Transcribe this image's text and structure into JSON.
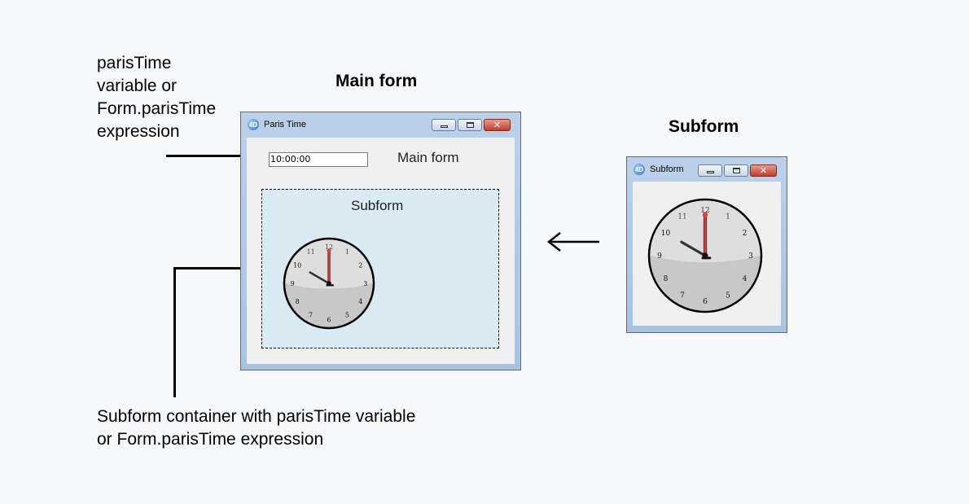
{
  "headings": {
    "main_form": "Main form",
    "subform": "Subform"
  },
  "annotations": {
    "top_left": [
      "parisTime",
      "variable or",
      "Form.parisTime",
      "expression"
    ],
    "bottom": [
      "Subform container with parisTime variable",
      "or Form.parisTime expression"
    ]
  },
  "main_window": {
    "title": "Paris Time",
    "time_value": "10:00:00",
    "label": "Main form",
    "subform_label": "Subform"
  },
  "subform_window": {
    "title": "Subform"
  },
  "window_buttons": {
    "close_glyph": "✕"
  },
  "clock": {
    "numbers": [
      "12",
      "1",
      "2",
      "3",
      "4",
      "5",
      "6",
      "7",
      "8",
      "9",
      "10",
      "11"
    ],
    "hour": 10,
    "minute": 0,
    "second": 0
  },
  "colors": {
    "second_hand": "#e04040",
    "container_fill": "#daebf4",
    "window_frame": "#a8c3e2"
  },
  "icons": {
    "app": "4d-app-icon",
    "arrow": "left-arrow-icon"
  }
}
